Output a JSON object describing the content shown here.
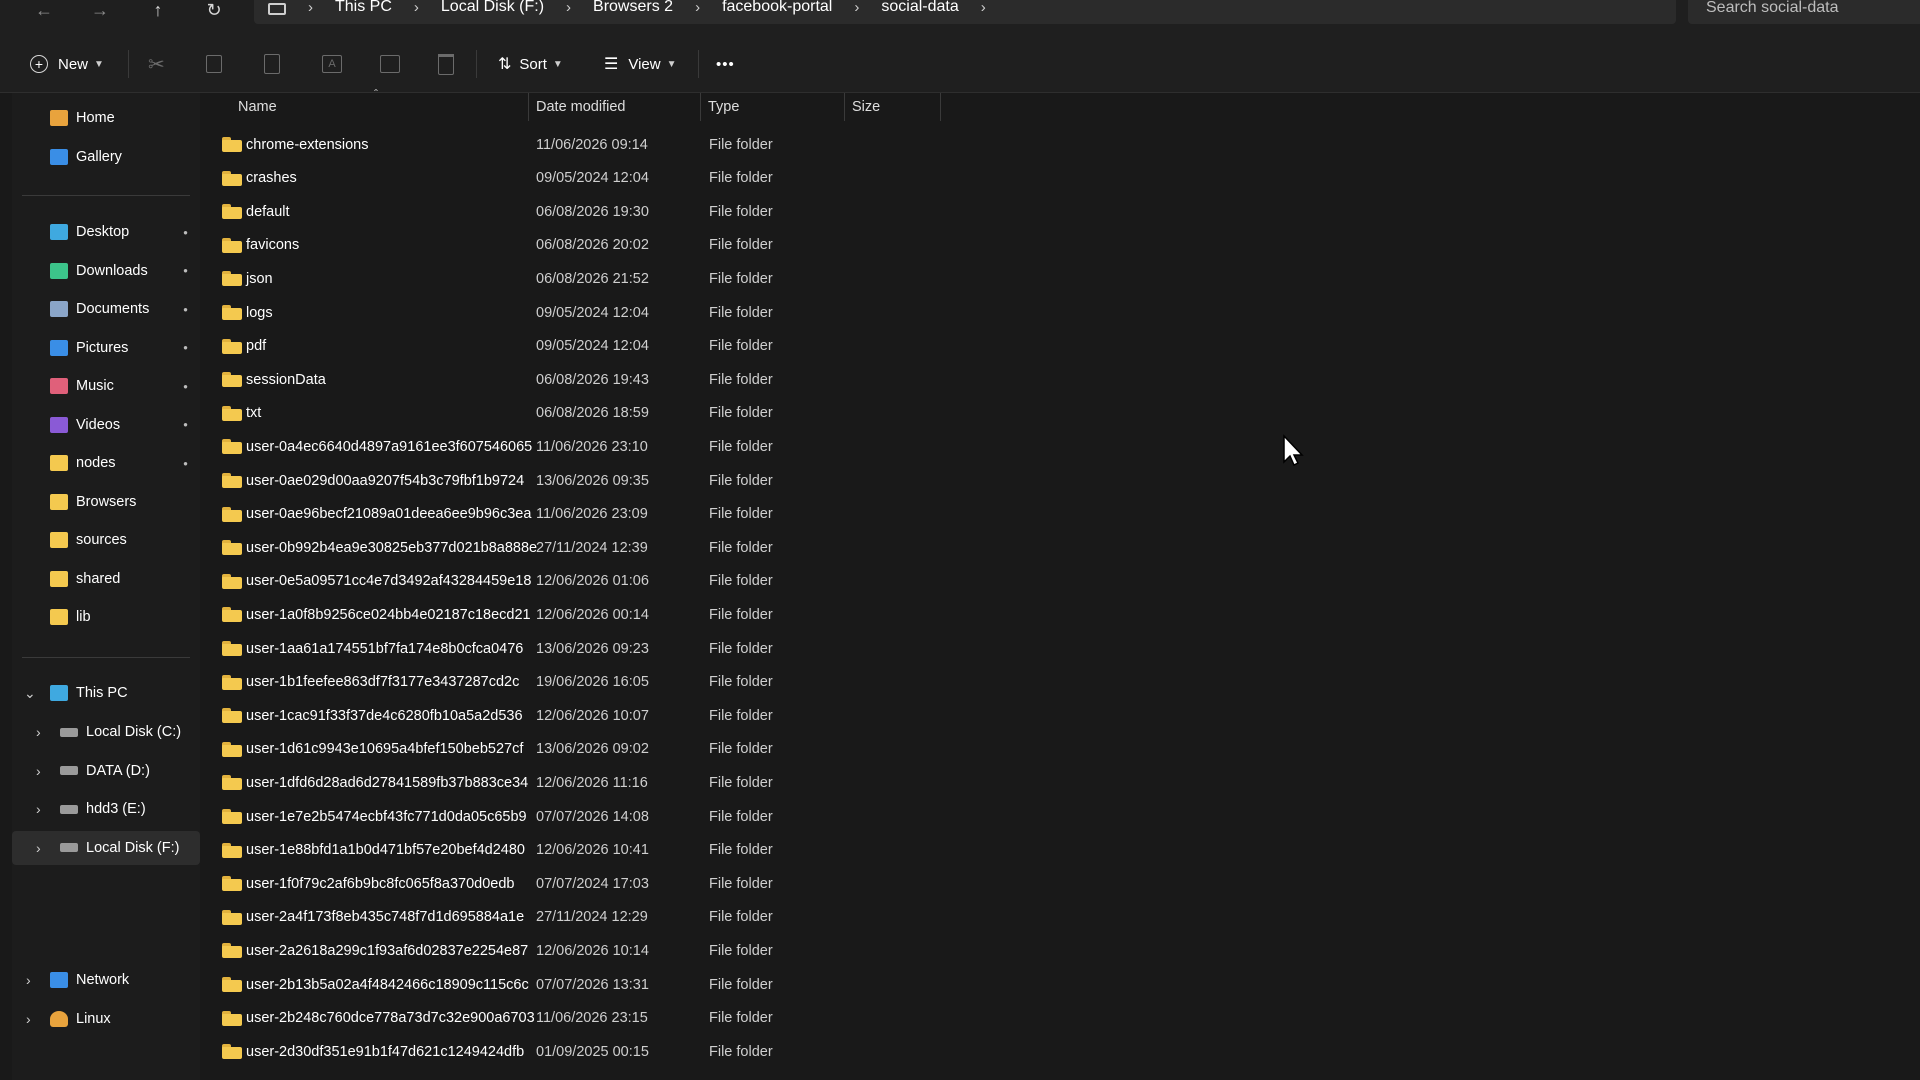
{
  "window": {
    "nav": {
      "back_icon": "arrow-left-icon",
      "forward_icon": "arrow-right-icon",
      "up_icon": "arrow-up-icon",
      "refresh_icon": "refresh-icon"
    },
    "breadcrumb": [
      "This PC",
      "Local Disk (F:)",
      "Browsers 2",
      "facebook-portal",
      "social-data"
    ],
    "search_placeholder": "Search social-data"
  },
  "toolbar": {
    "new_label": "New",
    "sort_label": "Sort",
    "view_label": "View",
    "more_label": "•••"
  },
  "sidebar": {
    "quick": [
      {
        "label": "Home",
        "icon": "home-icon",
        "color": "#e8a33d"
      },
      {
        "label": "Gallery",
        "icon": "gallery-icon",
        "color": "#3a8ee6"
      }
    ],
    "pinned": [
      {
        "label": "Desktop",
        "icon": "desktop-icon",
        "color": "#3fa9e0"
      },
      {
        "label": "Downloads",
        "icon": "download-icon",
        "color": "#3cc48a"
      },
      {
        "label": "Documents",
        "icon": "documents-icon",
        "color": "#8aa5c8"
      },
      {
        "label": "Pictures",
        "icon": "pictures-icon",
        "color": "#3a8ee6"
      },
      {
        "label": "Music",
        "icon": "music-icon",
        "color": "#e0607a"
      },
      {
        "label": "Videos",
        "icon": "videos-icon",
        "color": "#8a5ad6"
      },
      {
        "label": "nodes",
        "icon": "folder-icon",
        "color": "#f4c94f"
      },
      {
        "label": "Browsers",
        "icon": "folder-icon",
        "color": "#f4c94f"
      },
      {
        "label": "sources",
        "icon": "folder-icon",
        "color": "#f4c94f"
      },
      {
        "label": "shared",
        "icon": "folder-icon",
        "color": "#f4c94f"
      },
      {
        "label": "lib",
        "icon": "folder-icon",
        "color": "#f4c94f"
      }
    ],
    "this_pc": "This PC",
    "drives": [
      {
        "label": "Local Disk (C:)",
        "icon": "windows-drive-icon"
      },
      {
        "label": "DATA (D:)",
        "icon": "drive-icon"
      },
      {
        "label": "hdd3 (E:)",
        "icon": "drive-icon"
      },
      {
        "label": "Local Disk (F:)",
        "icon": "drive-icon",
        "selected": true
      }
    ],
    "network": "Network",
    "linux": "Linux"
  },
  "columns": [
    "Name",
    "Date modified",
    "Type",
    "Size"
  ],
  "files": [
    {
      "name": "chrome-extensions",
      "date": "11/06/2026 09:14",
      "type": "File folder"
    },
    {
      "name": "crashes",
      "date": "09/05/2024 12:04",
      "type": "File folder"
    },
    {
      "name": "default",
      "date": "06/08/2026 19:30",
      "type": "File folder"
    },
    {
      "name": "favicons",
      "date": "06/08/2026 20:02",
      "type": "File folder"
    },
    {
      "name": "json",
      "date": "06/08/2026 21:52",
      "type": "File folder"
    },
    {
      "name": "logs",
      "date": "09/05/2024 12:04",
      "type": "File folder"
    },
    {
      "name": "pdf",
      "date": "09/05/2024 12:04",
      "type": "File folder"
    },
    {
      "name": "sessionData",
      "date": "06/08/2026 19:43",
      "type": "File folder"
    },
    {
      "name": "txt",
      "date": "06/08/2026 18:59",
      "type": "File folder"
    },
    {
      "name": "user-0a4ec6640d4897a9161ee3f607546065",
      "date": "11/06/2026 23:10",
      "type": "File folder"
    },
    {
      "name": "user-0ae029d00aa9207f54b3c79fbf1b9724",
      "date": "13/06/2026 09:35",
      "type": "File folder"
    },
    {
      "name": "user-0ae96becf21089a01deea6ee9b96c3ea",
      "date": "11/06/2026 23:09",
      "type": "File folder"
    },
    {
      "name": "user-0b992b4ea9e30825eb377d021b8a888e",
      "date": "27/11/2024 12:39",
      "type": "File folder"
    },
    {
      "name": "user-0e5a09571cc4e7d3492af43284459e18",
      "date": "12/06/2026 01:06",
      "type": "File folder"
    },
    {
      "name": "user-1a0f8b9256ce024bb4e02187c18ecd21",
      "date": "12/06/2026 00:14",
      "type": "File folder"
    },
    {
      "name": "user-1aa61a174551bf7fa174e8b0cfca0476",
      "date": "13/06/2026 09:23",
      "type": "File folder"
    },
    {
      "name": "user-1b1feefee863df7f3177e3437287cd2c",
      "date": "19/06/2026 16:05",
      "type": "File folder"
    },
    {
      "name": "user-1cac91f33f37de4c6280fb10a5a2d536",
      "date": "12/06/2026 10:07",
      "type": "File folder"
    },
    {
      "name": "user-1d61c9943e10695a4bfef150beb527cf",
      "date": "13/06/2026 09:02",
      "type": "File folder"
    },
    {
      "name": "user-1dfd6d28ad6d27841589fb37b883ce34",
      "date": "12/06/2026 11:16",
      "type": "File folder"
    },
    {
      "name": "user-1e7e2b5474ecbf43fc771d0da05c65b9",
      "date": "07/07/2026 14:08",
      "type": "File folder"
    },
    {
      "name": "user-1e88bfd1a1b0d471bf57e20bef4d2480",
      "date": "12/06/2026 10:41",
      "type": "File folder"
    },
    {
      "name": "user-1f0f79c2af6b9bc8fc065f8a370d0edb",
      "date": "07/07/2024 17:03",
      "type": "File folder"
    },
    {
      "name": "user-2a4f173f8eb435c748f7d1d695884a1e",
      "date": "27/11/2024 12:29",
      "type": "File folder"
    },
    {
      "name": "user-2a2618a299c1f93af6d02837e2254e87",
      "date": "12/06/2026 10:14",
      "type": "File folder"
    },
    {
      "name": "user-2b13b5a02a4f4842466c18909c115c6c",
      "date": "07/07/2026 13:31",
      "type": "File folder"
    },
    {
      "name": "user-2b248c760dce778a73d7c32e900a6703",
      "date": "11/06/2026 23:15",
      "type": "File folder"
    },
    {
      "name": "user-2d30df351e91b1f47d621c1249424dfb",
      "date": "01/09/2025 00:15",
      "type": "File folder"
    }
  ]
}
